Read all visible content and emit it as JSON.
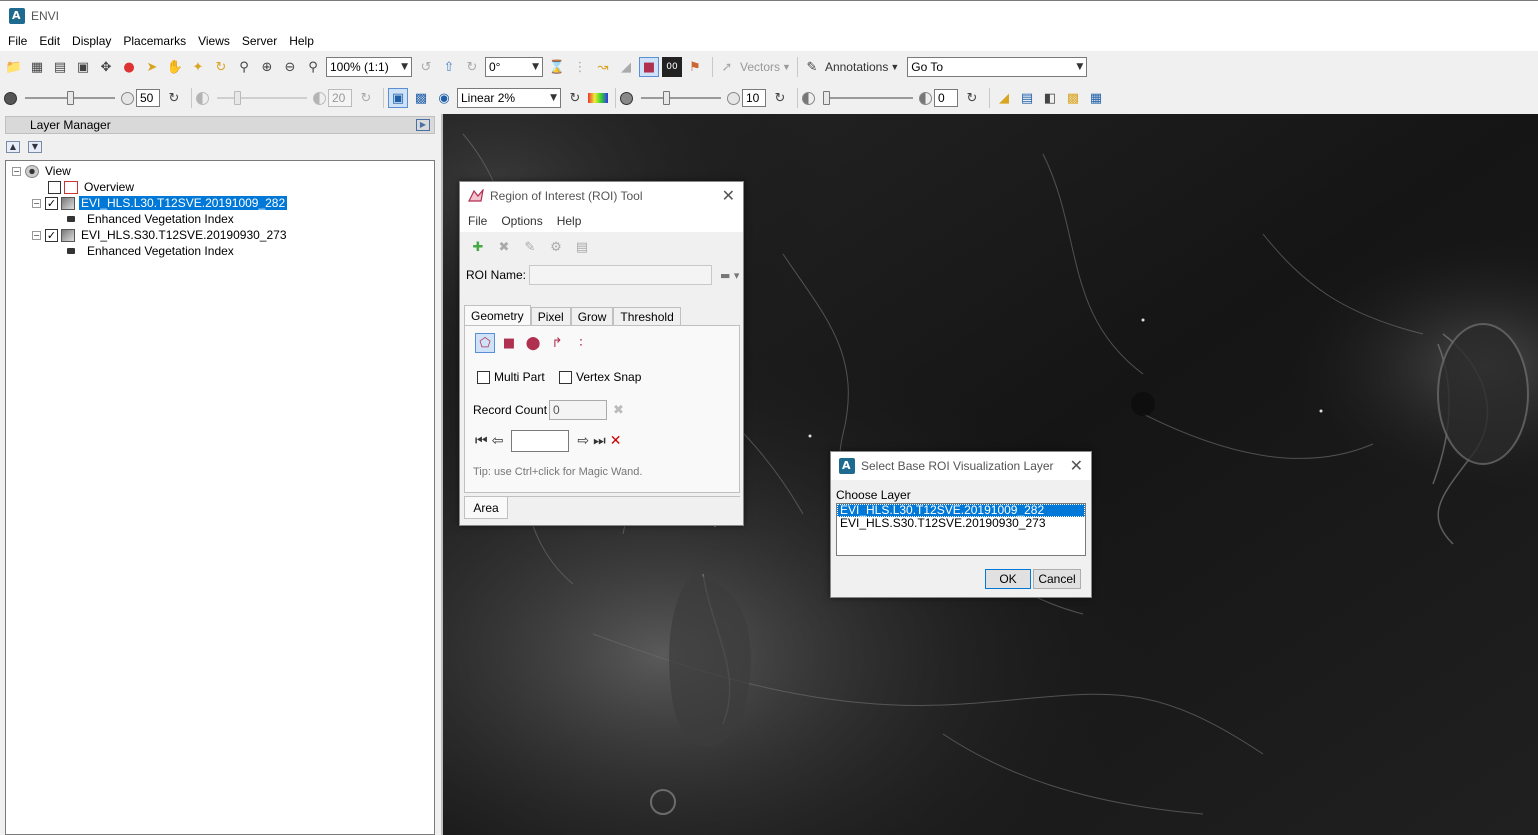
{
  "window": {
    "title": "ENVI"
  },
  "menubar": {
    "items": [
      "File",
      "Edit",
      "Display",
      "Placemarks",
      "Views",
      "Server",
      "Help"
    ]
  },
  "toolbar1": {
    "zoom_value": "100% (1:1)",
    "rotation_value": "0°",
    "vectors_label": "Vectors",
    "annotations_label": "Annotations",
    "goto_value": "Go To"
  },
  "toolbar2": {
    "brightness_value": "50",
    "contrast_value": "20",
    "stretch_value": "Linear 2%",
    "sharpen_value": "10",
    "transparency_value": "0",
    "brightness_level": 0.5,
    "contrast_level": 0.2,
    "sharpen_level": 0.3,
    "transparency_level": 0.0
  },
  "layer_manager": {
    "title": "Layer Manager",
    "tree": {
      "root": "View",
      "overview": "Overview",
      "layers": [
        {
          "name": "EVI_HLS.L30.T12SVE.20191009_282",
          "band": "Enhanced Vegetation Index",
          "checked": true,
          "selected": true
        },
        {
          "name": "EVI_HLS.S30.T12SVE.20190930_273",
          "band": "Enhanced Vegetation Index",
          "checked": true,
          "selected": false
        }
      ]
    }
  },
  "roi_tool": {
    "title": "Region of Interest (ROI) Tool",
    "menu": [
      "File",
      "Options",
      "Help"
    ],
    "roi_name_label": "ROI Name:",
    "tabs": [
      "Geometry",
      "Pixel",
      "Grow",
      "Threshold"
    ],
    "multi_part_label": "Multi Part",
    "vertex_snap_label": "Vertex Snap",
    "record_count_label": "Record Count",
    "record_count_value": "0",
    "tip": "Tip: use Ctrl+click for Magic Wand.",
    "bottom_tab": "Area"
  },
  "select_dialog": {
    "title": "Select Base ROI Visualization Layer",
    "choose_label": "Choose Layer",
    "options": [
      "EVI_HLS.L30.T12SVE.20191009_282",
      "EVI_HLS.S30.T12SVE.20190930_273"
    ],
    "selected_index": 0,
    "ok_label": "OK",
    "cancel_label": "Cancel"
  },
  "colors": {
    "selection": "#0078d7",
    "image_background": "#111111"
  }
}
